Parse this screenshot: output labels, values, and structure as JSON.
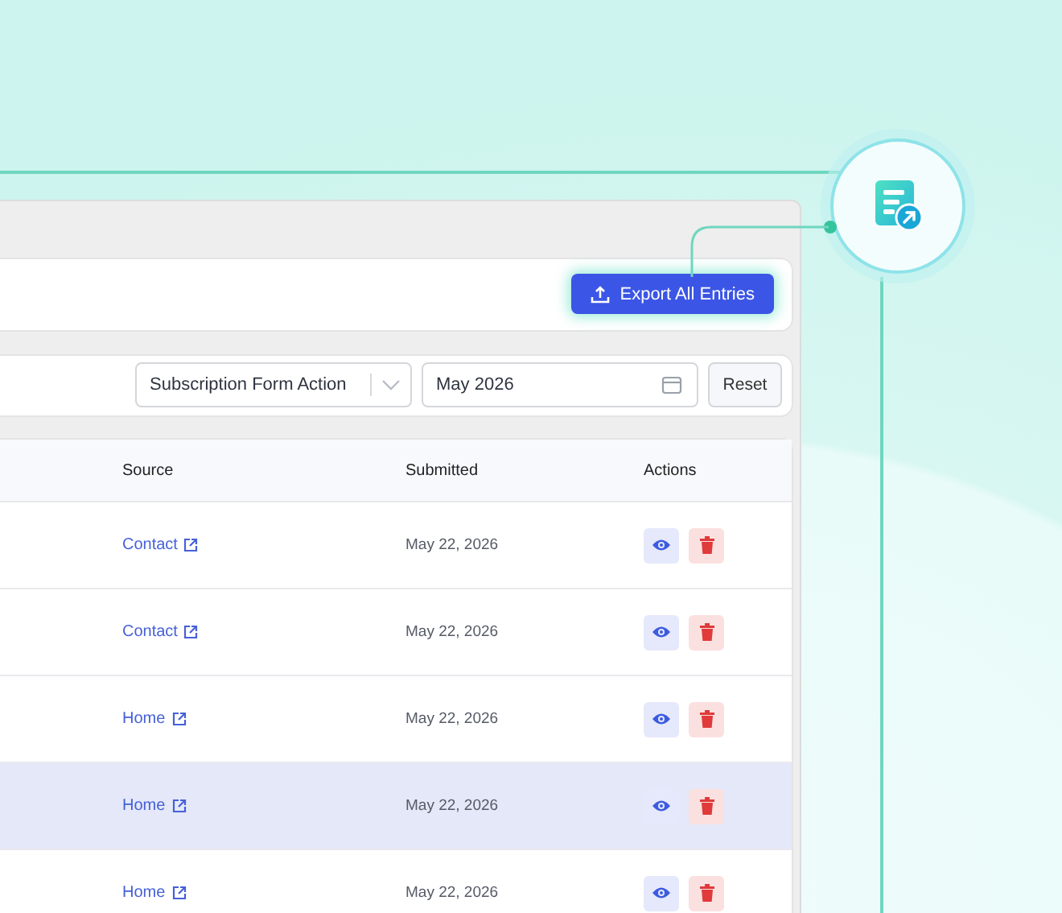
{
  "export_button": {
    "label": "Export All Entries"
  },
  "filters": {
    "form_select": {
      "value": "Subscription Form Action"
    },
    "date_field": {
      "value": "May 2026"
    },
    "reset_button": {
      "label": "Reset"
    }
  },
  "table": {
    "columns": [
      "Source",
      "Submitted",
      "Actions"
    ],
    "rows": [
      {
        "source": "Contact",
        "submitted": "May 22, 2026",
        "hovered": false
      },
      {
        "source": "Contact",
        "submitted": "May 22, 2026",
        "hovered": false
      },
      {
        "source": "Home",
        "submitted": "May 22, 2026",
        "hovered": false
      },
      {
        "source": "Home",
        "submitted": "May 22, 2026",
        "hovered": true
      },
      {
        "source": "Home",
        "submitted": "May 22, 2026",
        "hovered": false
      }
    ]
  }
}
